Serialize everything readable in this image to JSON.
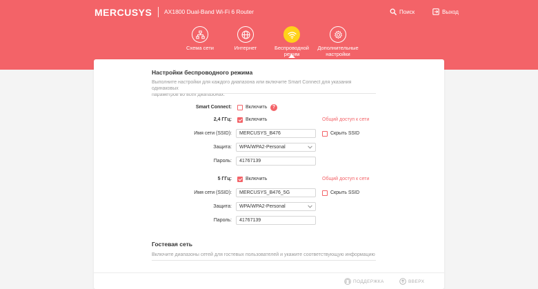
{
  "header": {
    "logo": "MERCUSYS",
    "model": "AX1800 Dual-Band Wi-Fi 6 Router",
    "search_label": "Поиск",
    "logout_label": "Выход",
    "accent_color": "#f36368",
    "active_color": "#ffd21a"
  },
  "nav": {
    "network_map": "Схема сети",
    "internet": "Интернет",
    "wireless_line1": "Беспроводной",
    "wireless_line2": "режим",
    "advanced_line1": "Дополнительные",
    "advanced_line2": "настройки"
  },
  "wireless": {
    "title": "Настройки беспроводного режима",
    "desc_line1": "Выполните настройки для каждого диапазона или включите Smart Connect для указания одинаковых",
    "desc_line2": "параметров во всех диапазонах.",
    "smart_connect": {
      "label": "Smart Connect:",
      "checkbox_label": "Включить",
      "checked": false
    },
    "band24": {
      "label": "2,4 ГГц:",
      "enable_label": "Включить",
      "enabled": true,
      "share_link": "Общий доступ к сети",
      "ssid_label": "Имя сети (SSID):",
      "ssid_value": "MERCUSYS_B476",
      "hide_ssid_label": "Скрыть SSID",
      "security_label": "Защита:",
      "security_value": "WPA/WPA2-Personal",
      "password_label": "Пароль:",
      "password_value": "41767139"
    },
    "band5": {
      "label": "5 ГГц:",
      "enable_label": "Включить",
      "enabled": true,
      "share_link": "Общий доступ к сети",
      "ssid_label": "Имя сети (SSID):",
      "ssid_value": "MERCUSYS_B476_5G",
      "hide_ssid_label": "Скрыть SSID",
      "security_label": "Защита:",
      "security_value": "WPA/WPA2-Personal",
      "password_label": "Пароль:",
      "password_value": "41767139"
    }
  },
  "guest": {
    "title": "Гостевая сеть",
    "desc": "Включите диапазоны сетей для гостевых пользователей и укажите соответствующую информацию"
  },
  "footer": {
    "support_label": "ПОДДЕРЖКА",
    "top_label": "ВВЕРХ"
  }
}
